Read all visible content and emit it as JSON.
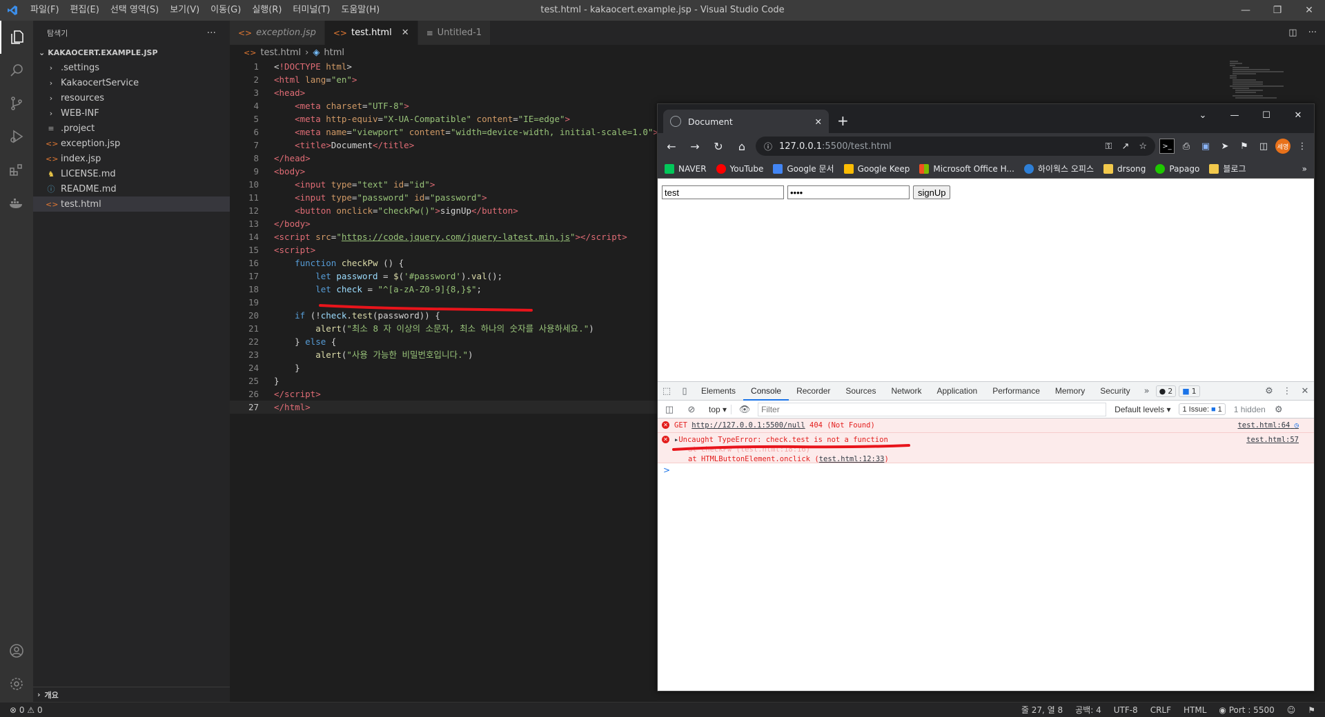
{
  "vscode": {
    "menu": [
      "파일(F)",
      "편집(E)",
      "선택 영역(S)",
      "보기(V)",
      "이동(G)",
      "실행(R)",
      "터미널(T)",
      "도움말(H)"
    ],
    "window_title": "test.html - kakaocert.example.jsp - Visual Studio Code",
    "explorer_title": "탐색기",
    "folder_name": "KAKAOCERT.EXAMPLE.JSP",
    "tree": [
      {
        "label": ".settings",
        "icon": "chevron-right-icon"
      },
      {
        "label": "KakaocertService",
        "icon": "chevron-right-icon"
      },
      {
        "label": "resources",
        "icon": "chevron-right-icon"
      },
      {
        "label": "WEB-INF",
        "icon": "chevron-right-icon"
      },
      {
        "label": ".project",
        "icon": "lines-icon"
      },
      {
        "label": "exception.jsp",
        "icon": "code-icon"
      },
      {
        "label": "index.jsp",
        "icon": "code-icon"
      },
      {
        "label": "LICENSE.md",
        "icon": "license-icon"
      },
      {
        "label": "README.md",
        "icon": "info-icon"
      },
      {
        "label": "test.html",
        "icon": "code-icon"
      }
    ],
    "outline_label": "개요",
    "tabs": [
      {
        "label": "exception.jsp"
      },
      {
        "label": "test.html"
      },
      {
        "label": "Untitled-1"
      }
    ],
    "breadcrumb": [
      "test.html",
      "html"
    ],
    "status": {
      "errors": "0",
      "warnings": "0",
      "position": "줄 27, 열 8",
      "spaces": "공백: 4",
      "encoding": "UTF-8",
      "eol": "CRLF",
      "language": "HTML",
      "port": "Port : 5500"
    }
  },
  "browser": {
    "tab_title": "Document",
    "url_host": "127.0.0.1",
    "url_path": ":5500/test.html",
    "avatar_text": "세영",
    "bookmarks": [
      "NAVER",
      "YouTube",
      "Google 문서",
      "Google Keep",
      "Microsoft Office H...",
      "하이웍스 오피스",
      "drsong",
      "Papago",
      "블로그"
    ],
    "page": {
      "text_input_value": "test",
      "password_input_value": "••••",
      "button_label": "signUp"
    },
    "devtools": {
      "tabs": [
        "Elements",
        "Console",
        "Recorder",
        "Sources",
        "Network",
        "Application",
        "Performance",
        "Memory",
        "Security"
      ],
      "error_count": "2",
      "info_count": "1",
      "context": "top",
      "filter_placeholder": "Filter",
      "levels": "Default levels",
      "issues_label": "1 Issue:",
      "issues_count": "1",
      "hidden_label": "1 hidden",
      "messages": [
        {
          "method": "GET",
          "url": "http://127.0.0.1:5500/null",
          "status": "404 (Not Found)",
          "source": "test.html:64"
        },
        {
          "text": "Uncaught TypeError: check.test is not a function",
          "source": "test.html:57",
          "stack_hidden": "at checkPw (test.html:18:16)",
          "stack_prefix": "at HTMLButtonElement.onclick",
          "stack_link": "test.html:12:33"
        }
      ],
      "prompt": ">"
    }
  },
  "colors": {
    "annotation": "#e8141b",
    "vscode_bg": "#1e1e1e",
    "error": "#e31d1c"
  }
}
